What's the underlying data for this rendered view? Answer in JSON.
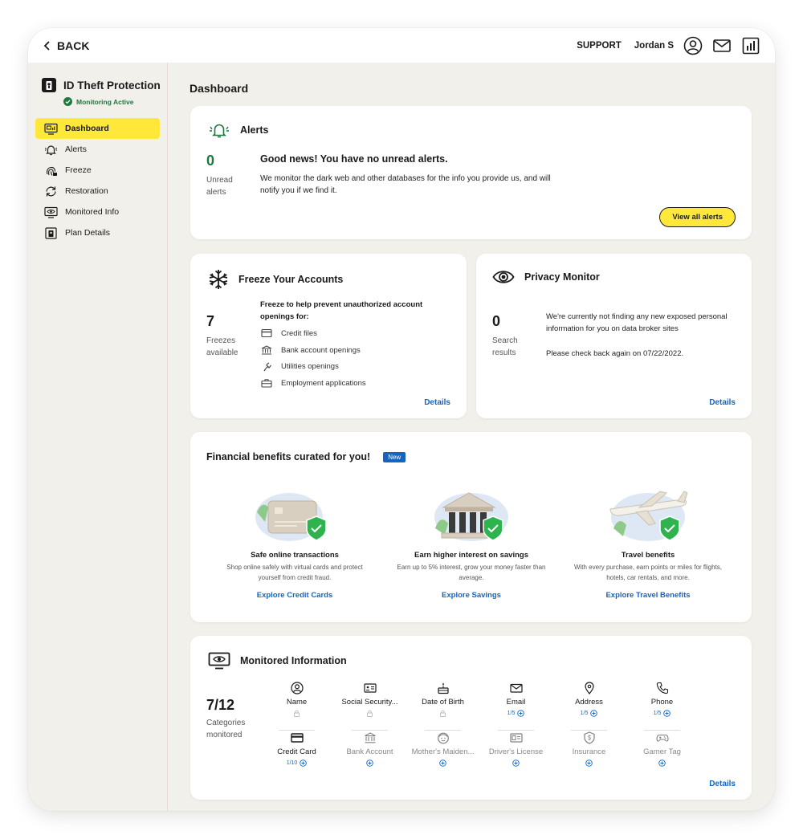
{
  "topbar": {
    "back_label": "BACK",
    "support_label": "SUPPORT",
    "user_name": "Jordan S"
  },
  "sidebar": {
    "title": "ID Theft Protection",
    "status": "Monitoring Active",
    "items": [
      {
        "label": "Dashboard",
        "icon": "dashboard-icon"
      },
      {
        "label": "Alerts",
        "icon": "bell-icon"
      },
      {
        "label": "Freeze",
        "icon": "fingerprint-icon"
      },
      {
        "label": "Restoration",
        "icon": "refresh-icon"
      },
      {
        "label": "Monitored Info",
        "icon": "monitor-eye-icon"
      },
      {
        "label": "Plan Details",
        "icon": "plan-icon"
      }
    ]
  },
  "main": {
    "page_title": "Dashboard",
    "alerts": {
      "title": "Alerts",
      "count": "0",
      "count_label": "Unread alerts",
      "headline": "Good news! You have no unread alerts.",
      "body": "We monitor the dark web and other databases for the info you provide us, and will notify you if we find it.",
      "button": "View all alerts"
    },
    "freeze": {
      "title": "Freeze Your Accounts",
      "count": "7",
      "count_label": "Freezes available",
      "intro": "Freeze to help prevent unauthorized account openings for:",
      "items": [
        "Credit files",
        "Bank account openings",
        "Utilities openings",
        "Employment applications"
      ],
      "details": "Details"
    },
    "privacy": {
      "title": "Privacy Monitor",
      "count": "0",
      "count_label": "Search results",
      "p1": "We're currently not finding any new exposed personal information for you on data broker sites",
      "p2": "Please check back again on 07/22/2022.",
      "details": "Details"
    },
    "financial": {
      "title": "Financial benefits curated for you!",
      "badge": "New",
      "benefits": [
        {
          "title": "Safe online transactions",
          "desc": "Shop online safely with virtual cards and protect yourself from credit fraud.",
          "link": "Explore Credit Cards"
        },
        {
          "title": "Earn higher interest on savings",
          "desc": "Earn up to 5% interest, grow your money faster than average.",
          "link": "Explore Savings"
        },
        {
          "title": "Travel benefits",
          "desc": "With every purchase, earn points or miles for flights, hotels, car rentals, and more.",
          "link": "Explore Travel Benefits"
        }
      ]
    },
    "monitored": {
      "title": "Monitored Information",
      "count": "7/12",
      "count_label": "Categories monitored",
      "categories": [
        {
          "name": "Name",
          "status": ""
        },
        {
          "name": "Social Security...",
          "status": ""
        },
        {
          "name": "Date of Birth",
          "status": ""
        },
        {
          "name": "Email",
          "status": "1/5"
        },
        {
          "name": "Address",
          "status": "1/5"
        },
        {
          "name": "Phone",
          "status": "1/5"
        },
        {
          "name": "Credit Card",
          "status": "1/10"
        },
        {
          "name": "Bank Account",
          "status": ""
        },
        {
          "name": "Mother's Maiden...",
          "status": ""
        },
        {
          "name": "Driver's License",
          "status": ""
        },
        {
          "name": "Insurance",
          "status": ""
        },
        {
          "name": "Gamer Tag",
          "status": ""
        }
      ],
      "details": "Details"
    }
  },
  "colors": {
    "accent_yellow": "#ffe83a",
    "link_blue": "#1565c0",
    "success_green": "#1c7a3f",
    "background": "#f2f0eb"
  }
}
